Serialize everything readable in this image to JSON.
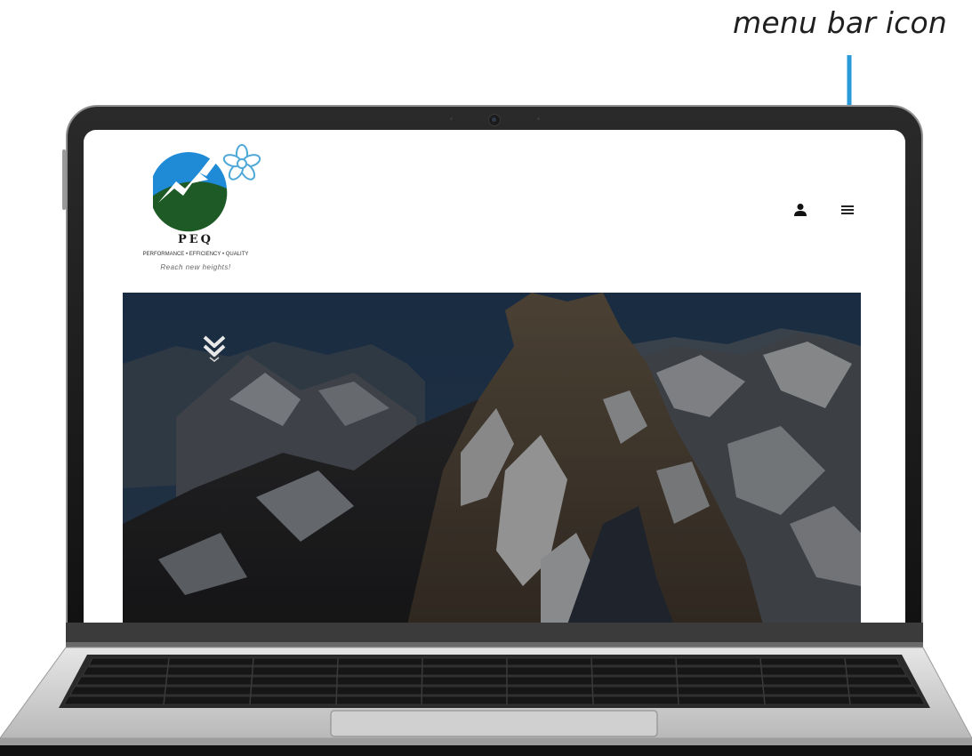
{
  "annotation": {
    "label": "menu bar icon",
    "arrow_color": "#2a9bd8"
  },
  "brand": {
    "name": "PEQ",
    "tagline": "PERFORMANCE • EFFICIENCY • QUALITY",
    "motto": "Reach new heights!",
    "colors": {
      "sky_blue": "#1f8ad6",
      "forest_green": "#1d5a26",
      "flower_blue": "#4fa8d8"
    }
  },
  "header": {
    "user_icon": "user-icon",
    "menu_icon": "hamburger-menu-icon"
  },
  "hero": {
    "scroll_icon": "double-chevron-down-icon"
  }
}
